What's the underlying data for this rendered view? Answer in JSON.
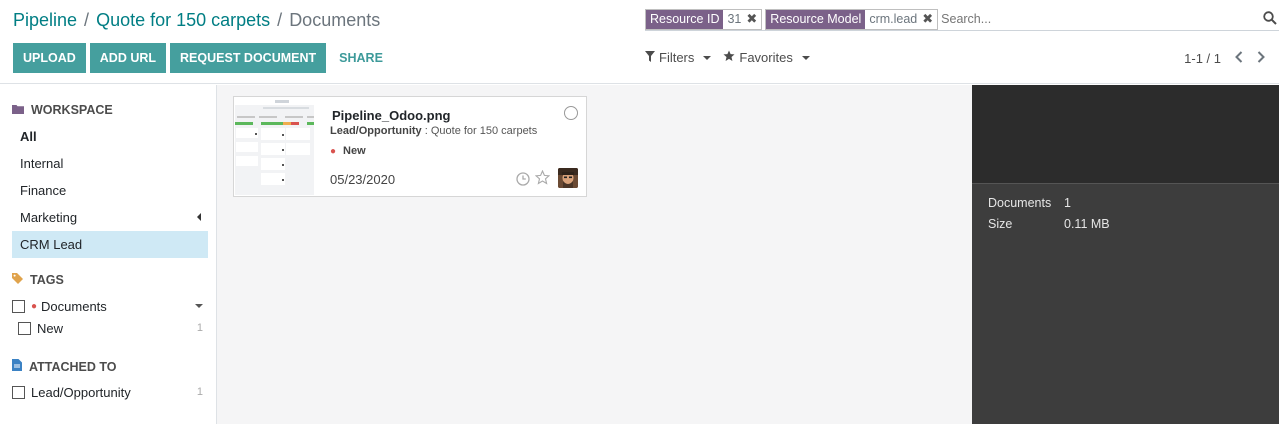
{
  "breadcrumb": {
    "items": [
      "Pipeline",
      "Quote for 150 carpets"
    ],
    "separator": "/",
    "current": "Documents"
  },
  "toolbar": {
    "upload_label": "UPLOAD",
    "add_url_label": "ADD URL",
    "request_label": "REQUEST DOCUMENT",
    "share_label": "SHARE"
  },
  "search": {
    "facets": [
      {
        "label": "Resource ID",
        "value": "31"
      },
      {
        "label": "Resource Model",
        "value": "crm.lead"
      }
    ],
    "placeholder": "Search...",
    "remove_glyph": "✖"
  },
  "filters": {
    "filters_label": "Filters",
    "favorites_label": "Favorites"
  },
  "pager": {
    "value": "1-1 / 1",
    "prev": "‹",
    "next": "›"
  },
  "sidebar": {
    "workspace_title": "WORKSPACE",
    "workspaces": [
      "All",
      "Internal",
      "Finance",
      "Marketing",
      "CRM Lead"
    ],
    "tags_title": "TAGS",
    "tag_group": "Documents",
    "tags": [
      {
        "label": "New",
        "count": "1"
      }
    ],
    "attached_title": "ATTACHED TO",
    "attached": [
      {
        "label": "Lead/Opportunity",
        "count": "1"
      }
    ]
  },
  "card": {
    "title": "Pipeline_Odoo.png",
    "model": "Lead/Opportunity",
    "record": " : Quote for 150 carpets",
    "tag": "New",
    "date": "05/23/2020"
  },
  "inspector": {
    "documents_label": "Documents",
    "documents_value": "1",
    "size_label": "Size",
    "size_value": "0.11 MB"
  },
  "colors": {
    "primary": "#459f9e",
    "facet": "#7b6189",
    "tag_dot": "#d9534f",
    "inspector_bg": "#3d3d3d"
  },
  "icons": [
    "search-icon",
    "filter-icon",
    "star-icon",
    "folder-icon",
    "tag-icon",
    "file-icon",
    "clock-icon",
    "star-outline-icon"
  ]
}
